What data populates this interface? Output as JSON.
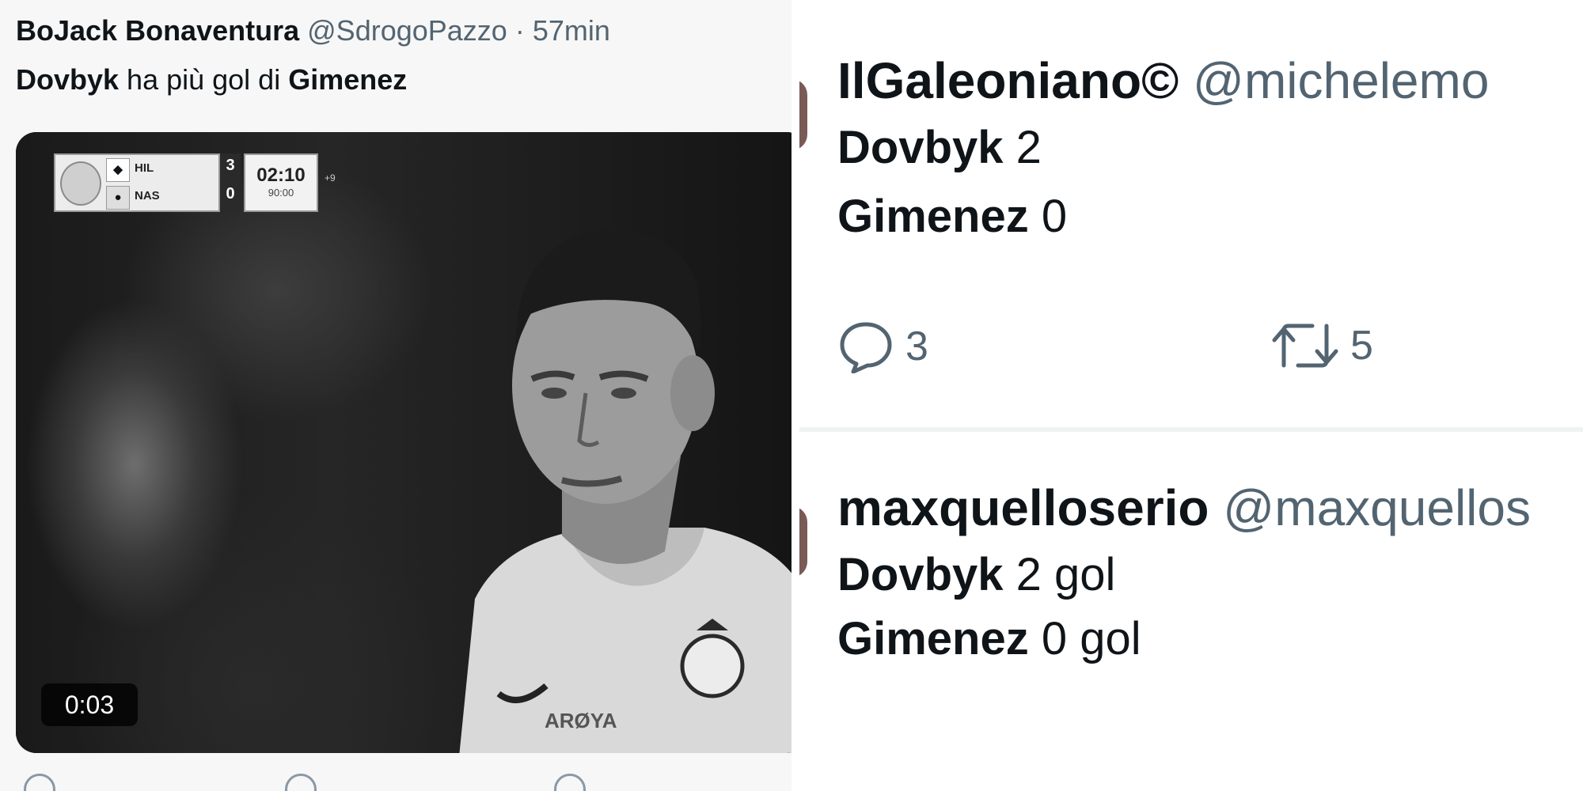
{
  "left_tweet": {
    "author_name": "BoJack Bonaventura",
    "handle": "@SdrogoPazzo",
    "separator": "·",
    "time": "57min",
    "text_parts": [
      "Dovbyk",
      " ha più gol di ",
      "Gimenez"
    ],
    "video": {
      "duration": "0:03",
      "scoreboard": {
        "team_home": "HIL",
        "team_away": "NAS",
        "score_home": "3",
        "score_away": "0",
        "clock": "02:10",
        "period": "90:00",
        "added": "+9"
      },
      "jersey_sponsor": "ARØYA"
    }
  },
  "right_tweets": [
    {
      "author_name": "IlGaleoniano©",
      "handle": "@michelemo",
      "lines": [
        {
          "name": "Dovbyk",
          "value": " 2"
        },
        {
          "name": "Gimenez",
          "value": " 0"
        }
      ],
      "replies": "3",
      "retweets": "5"
    },
    {
      "author_name": "maxquelloserio",
      "handle": "@maxquellos",
      "lines": [
        {
          "name": "Dovbyk",
          "value": " 2 gol"
        },
        {
          "name": "Gimenez",
          "value": " 0 gol"
        }
      ]
    }
  ],
  "colors": {
    "text": "#0f1419",
    "secondary": "#536471",
    "divider": "#eff3f4"
  },
  "icons": [
    "reply-icon",
    "retweet-icon"
  ]
}
